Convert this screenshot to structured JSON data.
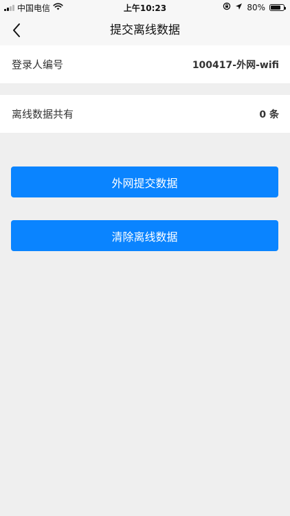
{
  "status_bar": {
    "carrier": "中国电信",
    "time": "上午10:23",
    "battery": "80%",
    "battery_level": 0.8,
    "icons": [
      "signal-icon",
      "wifi-icon",
      "rotation-lock-icon",
      "location-arrow-icon",
      "battery-icon"
    ]
  },
  "nav": {
    "title": "提交离线数据",
    "back_icon": "chevron-left-icon"
  },
  "rows": {
    "login": {
      "label": "登录人编号",
      "value": "100417-外网-wifi"
    },
    "offline": {
      "label": "离线数据共有",
      "value": "0",
      "unit": "条"
    }
  },
  "buttons": {
    "submit": "外网提交数据",
    "clear": "清除离线数据"
  },
  "colors": {
    "accent": "#0a84ff",
    "background": "#efefef",
    "bar": "#f7f7f7"
  }
}
